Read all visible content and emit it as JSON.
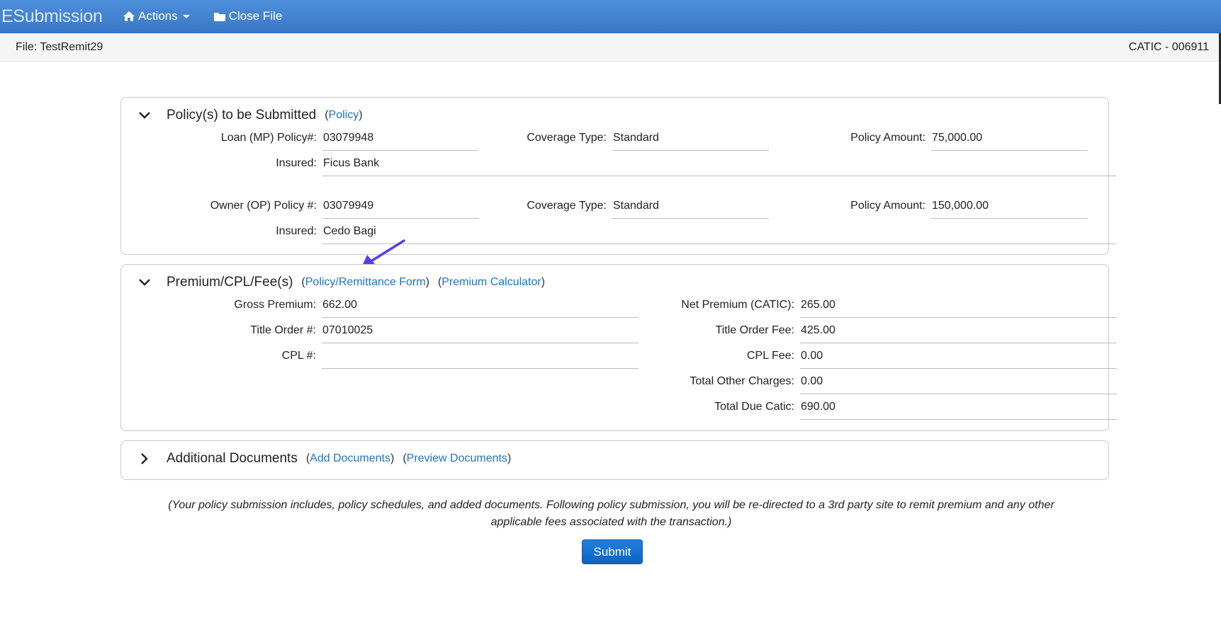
{
  "nav": {
    "brand": "ESubmission",
    "actions_label": "Actions",
    "close_file_label": "Close File"
  },
  "filebar": {
    "file_label": "File: TestRemit29",
    "agent_code": "CATIC - 006911"
  },
  "policies": {
    "title": "Policy(s) to be Submitted",
    "link": "Policy",
    "loan": {
      "policy_label": "Loan (MP) Policy#:",
      "policy_value": "03079948",
      "coverage_label": "Coverage Type:",
      "coverage_value": "Standard",
      "amount_label": "Policy Amount:",
      "amount_value": "75,000.00",
      "insured_label": "Insured:",
      "insured_value": "Ficus Bank"
    },
    "owner": {
      "policy_label": "Owner (OP) Policy #:",
      "policy_value": "03079949",
      "coverage_label": "Coverage Type:",
      "coverage_value": "Standard",
      "amount_label": "Policy Amount:",
      "amount_value": "150,000.00",
      "insured_label": "Insured:",
      "insured_value": "Cedo Bagi"
    }
  },
  "premium": {
    "title": "Premium/CPL/Fee(s)",
    "link1": "Policy/Remittance Form",
    "link2": "Premium Calculator",
    "left": [
      {
        "label": "Gross Premium:",
        "value": "662.00"
      },
      {
        "label": "Title Order #:",
        "value": "07010025"
      },
      {
        "label": "CPL #:",
        "value": ""
      }
    ],
    "right": [
      {
        "label": "Net Premium (CATIC):",
        "value": "265.00"
      },
      {
        "label": "Title Order Fee:",
        "value": "425.00"
      },
      {
        "label": "CPL Fee:",
        "value": "0.00"
      },
      {
        "label": "Total Other Charges:",
        "value": "0.00"
      },
      {
        "label": "Total Due Catic:",
        "value": "690.00"
      }
    ]
  },
  "additional": {
    "title": "Additional Documents",
    "link1": "Add Documents",
    "link2": "Preview Documents"
  },
  "note": {
    "line1": "(Your policy submission includes, policy schedules, and added documents. Following policy submission, you will be re-directed to a 3rd party site to remit premium and any other",
    "line2": "applicable fees associated with the transaction.)"
  },
  "submit_label": "Submit",
  "colors": {
    "navbar": "#3a78c7",
    "link": "#1e74c4",
    "submit": "#0d63c2",
    "annotation_arrow": "#5b3de8"
  },
  "icons": [
    "home-icon",
    "folder-icon",
    "chevron-down-icon",
    "chevron-right-icon"
  ]
}
